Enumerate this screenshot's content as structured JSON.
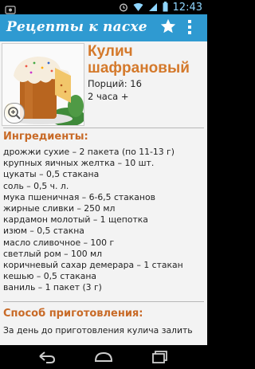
{
  "status_bar": {
    "time": "12:43",
    "icons": [
      "debug-icon",
      "alarm-icon",
      "wifi-icon",
      "signal-icon",
      "battery-icon"
    ]
  },
  "action_bar": {
    "title": "Рецепты к пасхе",
    "icons": [
      "star-icon",
      "overflow-menu-icon"
    ],
    "color": "#2f9ad1"
  },
  "recipe": {
    "title": "Кулич шафрановый",
    "portions": "Порций: 16",
    "time": "2 часа +",
    "photo_icon": "zoom-in-icon"
  },
  "ingredients": {
    "heading": "Ингредиенты:",
    "items": [
      "дрожжи сухие – 2 пакета (по 11-13 г)",
      "крупных яичных желтка – 10 шт.",
      "цукаты – 0,5 стакана",
      "соль – 0,5 ч. л.",
      "мука пшеничная – 6-6,5 стаканов",
      "жирные сливки – 250 мл",
      "кардамон молотый – 1 щепотка",
      "изюм – 0,5 стакна",
      "масло сливочное – 100 г",
      "светлый ром – 100 мл",
      "коричневый сахар демерара – 1 стакан",
      "кешью – 0,5 стакана",
      "ваниль – 1 пакет (3 г)"
    ]
  },
  "method": {
    "heading": "Способ приготовления:",
    "text": "За день до приготовления кулича залить"
  },
  "nav_bar": {
    "icons": [
      "back-icon",
      "home-icon",
      "recents-icon"
    ]
  },
  "colors": {
    "accent": "#d4792b",
    "action_bar": "#2f9ad1",
    "background": "#f3f3f3"
  }
}
